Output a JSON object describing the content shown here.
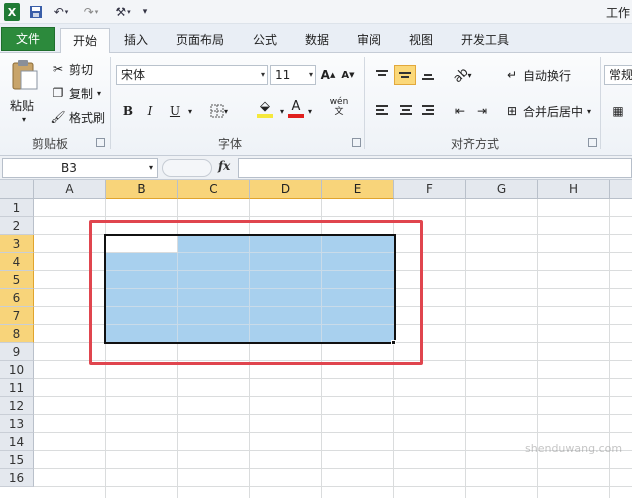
{
  "app": {
    "title": "工作",
    "icon": "excel-logo-icon"
  },
  "quick_access": {
    "save_icon": "save-icon",
    "undo_icon": "undo-icon",
    "redo_icon": "redo-icon",
    "customize_icon": "customize-tools-icon"
  },
  "tabs": [
    {
      "label": "文件"
    },
    {
      "label": "开始"
    },
    {
      "label": "插入"
    },
    {
      "label": "页面布局"
    },
    {
      "label": "公式"
    },
    {
      "label": "数据"
    },
    {
      "label": "审阅"
    },
    {
      "label": "视图"
    },
    {
      "label": "开发工具"
    }
  ],
  "active_tab": "开始",
  "ribbon": {
    "clipboard": {
      "paste": "粘贴",
      "cut": "剪切",
      "copy": "复制",
      "format_painter": "格式刷",
      "group": "剪贴板"
    },
    "font": {
      "name": "宋体",
      "size": "11",
      "bold": "B",
      "italic": "I",
      "underline": "U",
      "font_color_letter": "A",
      "phonetic": "wén 文",
      "group": "字体"
    },
    "alignment": {
      "wrap": "自动换行",
      "merge": "合并后居中",
      "group": "对齐方式"
    },
    "number": {
      "format": "常规"
    }
  },
  "formula_bar": {
    "name_box": "B3",
    "fx": "fx",
    "formula": ""
  },
  "sheet": {
    "columns": [
      "A",
      "B",
      "C",
      "D",
      "E",
      "F",
      "G",
      "H"
    ],
    "rows": [
      "1",
      "2",
      "3",
      "4",
      "5",
      "6",
      "7",
      "8",
      "9",
      "10",
      "11",
      "12",
      "13",
      "14",
      "15",
      "16"
    ],
    "selected_range": "B3:E8",
    "active_cell": "B3"
  },
  "colors": {
    "selection": "#a8d0ee",
    "annotation": "#e0454e",
    "file_tab": "#2c8a3c",
    "header_selected": "#f8d47a"
  },
  "watermark": "shenduwang.com"
}
